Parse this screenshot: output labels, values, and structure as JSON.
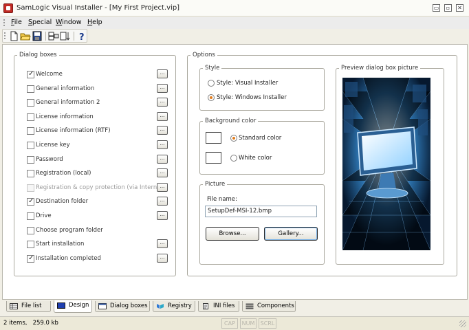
{
  "window": {
    "app_name": "SamLogic Visual Installer",
    "title": "SamLogic Visual Installer - [My First Project.vip]",
    "minimize": "▭",
    "restore": "▫",
    "close": "✕"
  },
  "menu": [
    {
      "label": "File",
      "mnemonic": "F"
    },
    {
      "label": "Special",
      "mnemonic": "S"
    },
    {
      "label": "Window",
      "mnemonic": "W"
    },
    {
      "label": "Help",
      "mnemonic": "H"
    }
  ],
  "toolbar": {
    "buttons": [
      "new-document-icon",
      "open-folder-icon",
      "save-disk-icon",
      "build-icon",
      "sort-icon",
      "help-icon"
    ]
  },
  "dialog_boxes": {
    "legend": "Dialog boxes",
    "items": [
      {
        "label": "Welcome",
        "checked": true,
        "enabled": true,
        "has_button": true
      },
      {
        "label": "General information",
        "checked": false,
        "enabled": true,
        "has_button": true
      },
      {
        "label": "General information 2",
        "checked": false,
        "enabled": true,
        "has_button": true
      },
      {
        "label": "License information",
        "checked": false,
        "enabled": true,
        "has_button": true
      },
      {
        "label": "License information (RTF)",
        "checked": false,
        "enabled": true,
        "has_button": true
      },
      {
        "label": "License key",
        "checked": false,
        "enabled": true,
        "has_button": true
      },
      {
        "label": "Password",
        "checked": false,
        "enabled": true,
        "has_button": true
      },
      {
        "label": "Registration (local)",
        "checked": false,
        "enabled": true,
        "has_button": true
      },
      {
        "label": "Registration & copy protection (via Internet)",
        "checked": false,
        "enabled": false,
        "has_button": true
      },
      {
        "label": "Destination folder",
        "checked": true,
        "enabled": true,
        "has_button": true
      },
      {
        "label": "Drive",
        "checked": false,
        "enabled": true,
        "has_button": true
      },
      {
        "label": "Choose program folder",
        "checked": false,
        "enabled": true,
        "has_button": false
      },
      {
        "label": "Start installation",
        "checked": false,
        "enabled": true,
        "has_button": true
      },
      {
        "label": "Installation completed",
        "checked": true,
        "enabled": true,
        "has_button": true
      }
    ],
    "button_label": "..."
  },
  "options": {
    "legend": "Options",
    "style": {
      "legend": "Style",
      "options": [
        {
          "label": "Style: Visual Installer",
          "selected": false
        },
        {
          "label": "Style: Windows Installer",
          "selected": true
        }
      ]
    },
    "background": {
      "legend": "Background color",
      "options": [
        {
          "label": "Standard color",
          "selected": true
        },
        {
          "label": "White color",
          "selected": false
        }
      ]
    },
    "picture": {
      "legend": "Picture",
      "file_label": "File name:",
      "file_value": "SetupDef-MSI-12.bmp",
      "browse_label": "Browse...",
      "gallery_label": "Gallery..."
    },
    "preview": {
      "legend": "Preview dialog box picture"
    }
  },
  "tabs": [
    {
      "label": "File list",
      "icon": "table-icon",
      "active": false
    },
    {
      "label": "Design",
      "icon": "monitor-icon",
      "active": true
    },
    {
      "label": "Dialog boxes",
      "icon": "dialog-icon",
      "active": false
    },
    {
      "label": "Registry",
      "icon": "registry-icon",
      "active": false
    },
    {
      "label": "INI files",
      "icon": "ini-file-icon",
      "active": false
    },
    {
      "label": "Components",
      "icon": "components-icon",
      "active": false
    }
  ],
  "status": {
    "items": "2 items,",
    "size": "259.0 kb",
    "panes": [
      "CAP",
      "NUM",
      "SCRL"
    ]
  },
  "colors": {
    "accent_radio": "#e07b1c",
    "window_bg": "#f1efe6",
    "preview_bg": "#0a2240"
  }
}
